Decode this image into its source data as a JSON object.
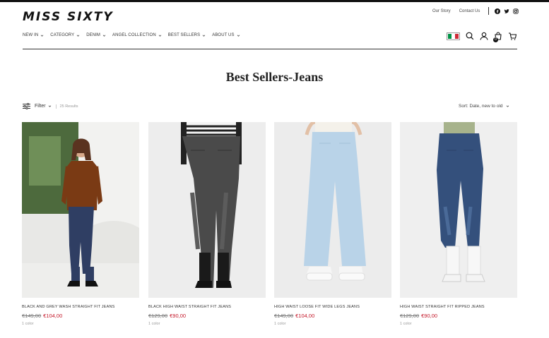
{
  "brand": "MISS SIXTY",
  "utility_links": [
    "Our Story",
    "Contact Us"
  ],
  "social_icons": [
    "facebook-icon",
    "twitter-icon",
    "instagram-icon"
  ],
  "nav": [
    {
      "label": "New in"
    },
    {
      "label": "Category"
    },
    {
      "label": "Denim"
    },
    {
      "label": "Angel collection"
    },
    {
      "label": "Best sellers"
    },
    {
      "label": "About us"
    }
  ],
  "header_icons": [
    "italy-flag-icon",
    "search-icon",
    "account-icon",
    "cart-icon",
    "wishlist-icon"
  ],
  "cart_count": "0",
  "colors": {
    "sale_price": "#c4182a",
    "italy_green": "#009246",
    "italy_red": "#ce2b37"
  },
  "page_title": "Best Sellers-Jeans",
  "filter": {
    "label": "Filter",
    "results": "25 Results"
  },
  "sort": {
    "label": "Sort: Date, new to old"
  },
  "products": [
    {
      "name": "Black and grey wash straight fit jeans",
      "old_price": "€149,00",
      "new_price": "€104,00",
      "colors": "1 color"
    },
    {
      "name": "Black high waist straight fit jeans",
      "old_price": "€129,00",
      "new_price": "€90,00",
      "colors": "1 color"
    },
    {
      "name": "High waist loose fit wide legs jeans",
      "old_price": "€149,00",
      "new_price": "€104,00",
      "colors": "1 color"
    },
    {
      "name": "High waist straight fit ripped jeans",
      "old_price": "€129,00",
      "new_price": "€90,00",
      "colors": "1 color"
    }
  ]
}
